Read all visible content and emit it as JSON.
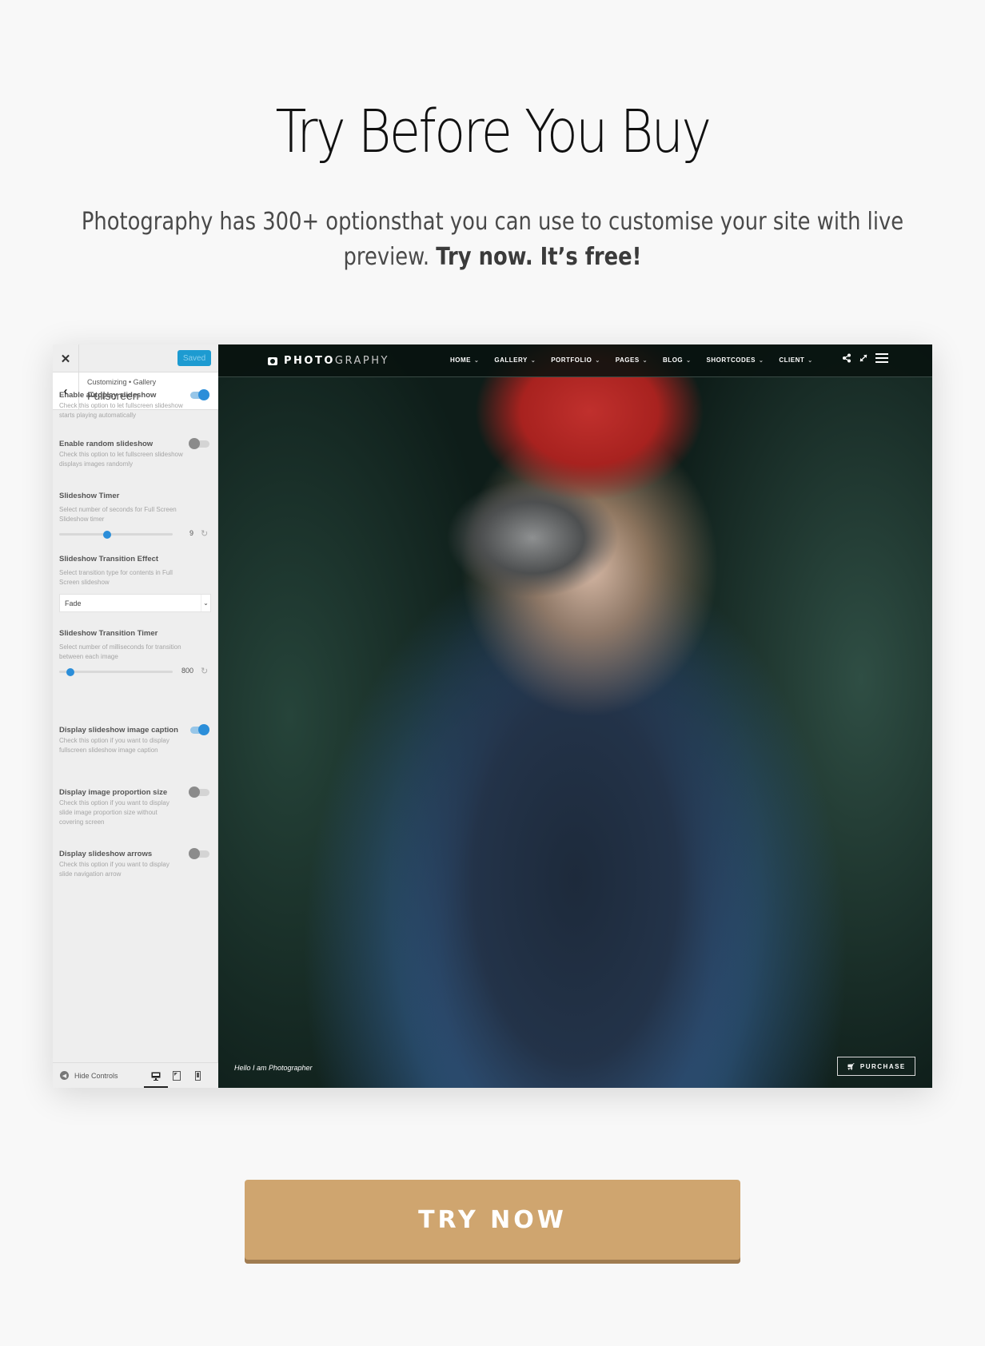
{
  "hero": {
    "title": "Try Before You Buy",
    "subtitle_part1": "Photography has 300+ optionsthat you can use to customise your site with live preview. ",
    "subtitle_bold": "Try now. It’s free!"
  },
  "customizer": {
    "close_icon": "close-icon",
    "saved_label": "Saved",
    "breadcrumb": "Customizing • Gallery",
    "section_title": "Fullscreen",
    "options": [
      {
        "title": "Enable autoplay slideshow",
        "desc": "Check this option to let fullscreen slideshow starts playing automatically",
        "type": "toggle",
        "on": true
      },
      {
        "title": "Enable random slideshow",
        "desc": "Check this option to let fullscreen slideshow displays images randomly",
        "type": "toggle",
        "on": false
      },
      {
        "title": "Slideshow Timer",
        "desc": "Select number of seconds for Full Screen Slideshow timer",
        "type": "slider",
        "value": "9",
        "fraction": 0.42
      },
      {
        "title": "Slideshow Transition Effect",
        "desc": "Select transition type for contents in Full Screen slideshow",
        "type": "select",
        "selected": "Fade"
      },
      {
        "title": "Slideshow Transition Timer",
        "desc": "Select number of milliseconds for transition between each image",
        "type": "slider",
        "value": "800",
        "fraction": 0.1
      },
      {
        "title": "Display slideshow image caption",
        "desc": "Check this option if you want to display fullscreen slideshow image caption",
        "type": "toggle",
        "on": true
      },
      {
        "title": "Display image proportion size",
        "desc": "Check this option if you want to display slide image proportion size without covering screen",
        "type": "toggle",
        "on": false
      },
      {
        "title": "Display slideshow arrows",
        "desc": "Check this option if you want to display slide navigation arrow",
        "type": "toggle",
        "on": false
      }
    ],
    "footer": {
      "hide_controls": "Hide Controls",
      "devices": [
        "desktop",
        "tablet",
        "mobile"
      ],
      "active_device": "desktop"
    },
    "accent_color": "#2b8ed9"
  },
  "preview": {
    "logo_bold": "PHOTO",
    "logo_light": "GRAPHY",
    "nav": [
      "HOME",
      "GALLERY",
      "PORTFOLIO",
      "PAGES",
      "BLOG",
      "SHORTCODES",
      "CLIENT"
    ],
    "caption": "Hello I am Photographer",
    "purchase_label": "PURCHASE"
  },
  "cta": {
    "label": "TRY NOW",
    "color": "#cfa56f"
  }
}
